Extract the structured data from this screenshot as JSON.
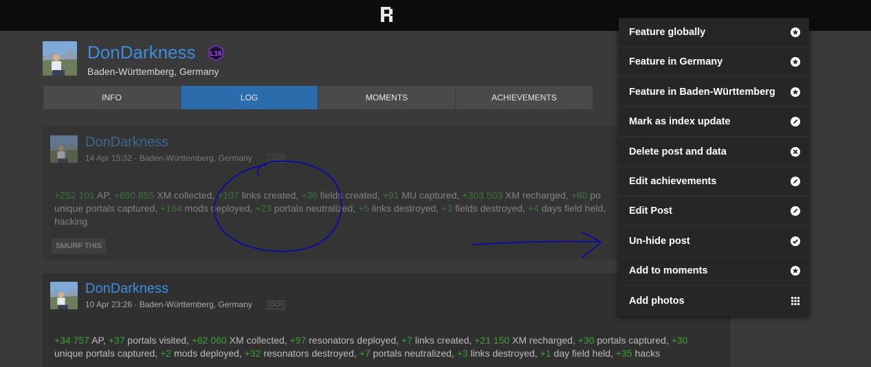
{
  "profile": {
    "name": "DonDarkness",
    "level": "L16",
    "location": "Baden-Württemberg, Germany"
  },
  "tabs": [
    {
      "label": "INFO"
    },
    {
      "label": "LOG"
    },
    {
      "label": "MOMENTS"
    },
    {
      "label": "ACHIEVEMENTS"
    }
  ],
  "posts": [
    {
      "author": "DonDarkness",
      "meta": "14 Apr 15:32 · Baden-Württemberg, Germany",
      "ocr_badge": "OCR",
      "stats": [
        [
          "+252 101",
          " AP, "
        ],
        [
          "+690 855",
          " XM collected, "
        ],
        [
          "+107",
          " links created, "
        ],
        [
          "+36",
          " fields created, "
        ],
        [
          "+91",
          " MU captured, "
        ],
        [
          "+303 503",
          " XM recharged, "
        ],
        [
          "+60",
          " po"
        ],
        [
          "",
          "unique portals captured, "
        ],
        [
          "+164",
          " mods deployed, "
        ],
        [
          "+23",
          " portals neutralized, "
        ],
        [
          "+5",
          " links destroyed, "
        ],
        [
          "+3",
          " fields destroyed, "
        ],
        [
          "+4",
          " days field held, "
        ],
        [
          "",
          "hacking"
        ]
      ],
      "button": "SMURF THIS"
    },
    {
      "author": "DonDarkness",
      "meta": "10 Apr 23:26 · Baden-Württemberg, Germany",
      "ocr_badge": "OCR",
      "stats": [
        [
          "+34 757",
          " AP, "
        ],
        [
          "+37",
          " portals visited, "
        ],
        [
          "+62 060",
          " XM collected, "
        ],
        [
          "+97",
          " resonators deployed, "
        ],
        [
          "+7",
          " links created, "
        ],
        [
          "+21 150",
          " XM recharged, "
        ],
        [
          "+30",
          " portals captured, "
        ],
        [
          "+30",
          ""
        ],
        [
          "",
          "unique portals captured, "
        ],
        [
          "+2",
          " mods deployed, "
        ],
        [
          "+32",
          " resonators destroyed, "
        ],
        [
          "+7",
          " portals neutralized, "
        ],
        [
          "+3",
          " links destroyed, "
        ],
        [
          "+1",
          " day field held, "
        ],
        [
          "+35",
          " hacks"
        ]
      ]
    }
  ],
  "menu": [
    {
      "label": "Feature globally",
      "icon": "star-icon"
    },
    {
      "label": "Feature in Germany",
      "icon": "star-icon"
    },
    {
      "label": "Feature in Baden-Württemberg",
      "icon": "star-icon"
    },
    {
      "label": "Mark as index update",
      "icon": "pencil-icon"
    },
    {
      "label": "Delete post and data",
      "icon": "x-icon"
    },
    {
      "label": "Edit achievements",
      "icon": "pencil-icon"
    },
    {
      "label": "Edit Post",
      "icon": "pencil-icon"
    },
    {
      "label": "Un-hide post",
      "icon": "check-icon"
    },
    {
      "label": "Add to moments",
      "icon": "star-icon"
    },
    {
      "label": "Add photos",
      "icon": "grid-icon"
    }
  ],
  "colors": {
    "accent_blue": "#3d8ee0",
    "active_tab": "#2b6cad",
    "stat_green": "#3aa336",
    "annotation_ink": "#0a0aa8"
  }
}
